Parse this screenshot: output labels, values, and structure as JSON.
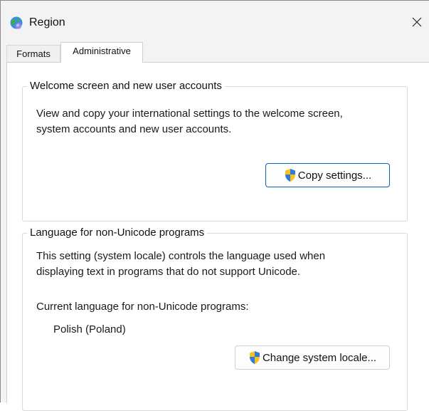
{
  "window": {
    "title": "Region",
    "icon": "globe-region-icon",
    "close_icon": "close-icon"
  },
  "tabs": [
    {
      "label": "Formats",
      "selected": false
    },
    {
      "label": "Administrative",
      "selected": true
    }
  ],
  "welcome_group": {
    "title": "Welcome screen and new user accounts",
    "description_line1": "View and copy your international settings to the welcome screen,",
    "description_line2": "system accounts and new user accounts.",
    "button_label": "Copy settings...",
    "button_icon": "uac-shield-icon"
  },
  "locale_group": {
    "title": "Language for non-Unicode programs",
    "description_line1": "This setting (system locale) controls the language used when",
    "description_line2": "displaying text in programs that do not support Unicode.",
    "current_label": "Current language for non-Unicode programs:",
    "current_value": "Polish (Poland)",
    "button_label": "Change system locale...",
    "button_icon": "uac-shield-icon"
  },
  "colors": {
    "accent": "#0a5fb8",
    "background": "#f3f3f3",
    "panel": "#ffffff",
    "shield_blue": "#2f7bd8",
    "shield_yellow": "#f6c21b"
  }
}
